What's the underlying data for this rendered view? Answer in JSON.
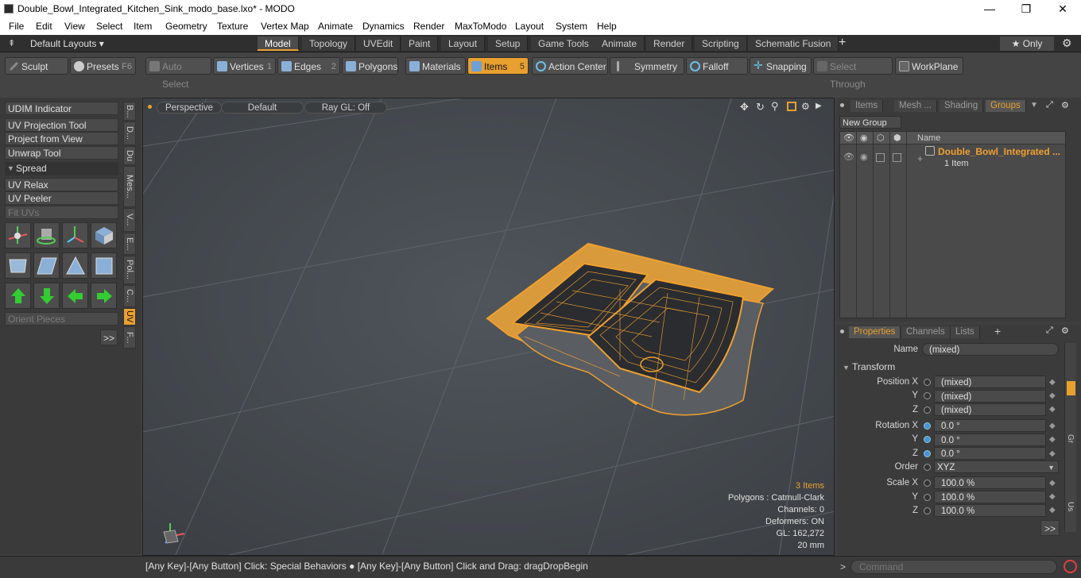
{
  "window": {
    "title": "Double_Bowl_Integrated_Kitchen_Sink_modo_base.lxo* - MODO",
    "minimize": "—",
    "maximize": "❐",
    "close": "✕"
  },
  "menu": [
    "File",
    "Edit",
    "View",
    "Select",
    "Item",
    "Geometry",
    "Texture",
    "Vertex Map",
    "Animate",
    "Dynamics",
    "Render",
    "MaxToModo",
    "Layout",
    "System",
    "Help"
  ],
  "layoutbar": {
    "layouts_label": "Default Layouts ▾",
    "tabs": [
      "Model",
      "Topology",
      "UVEdit",
      "Paint",
      "Layout",
      "Setup",
      "Game Tools",
      "Animate",
      "Render",
      "Scripting",
      "Schematic Fusion"
    ],
    "active_tab": "Model",
    "add": "+",
    "only_label": "★  Only"
  },
  "toolbar": {
    "sculpt": "Sculpt",
    "presets": "Presets",
    "presets_key": "F6",
    "auto_select": "Auto Select",
    "vertices": "Vertices",
    "vertices_key": "1",
    "edges": "Edges",
    "edges_key": "2",
    "polygons": "Polygons",
    "materials": "Materials",
    "items": "Items",
    "items_key": "5",
    "action_center": "Action Center",
    "symmetry": "Symmetry",
    "falloff": "Falloff",
    "snapping": "Snapping",
    "select_through": "Select Through",
    "workplane": "WorkPlane"
  },
  "leftpanel": {
    "udim": "UDIM Indicator",
    "uv_projection": "UV Projection Tool",
    "project_view": "Project from View",
    "unwrap": "Unwrap Tool",
    "spread": "Spread",
    "uv_relax": "UV Relax",
    "uv_peeler": "UV Peeler",
    "fit_uvs": "Fit UVs",
    "orient": "Orient Pieces",
    "more": ">>",
    "vtabs": [
      "B...",
      "D...",
      "Du",
      "Mes...",
      "V...",
      "E...",
      "Pol...",
      "C...",
      "UV",
      "F..."
    ]
  },
  "viewport": {
    "perspective": "Perspective",
    "default": "Default",
    "raygl": "Ray GL: Off",
    "items_count": "3 Items",
    "polygons": "Polygons : Catmull-Clark",
    "channels": "Channels: 0",
    "deformers": "Deformers: ON",
    "gl": "GL: 162,272",
    "unit": "20 mm"
  },
  "status": {
    "text": "[Any Key]-[Any Button] Click: Special Behaviors ● [Any Key]-[Any Button] Click and Drag: dragDropBegin"
  },
  "groups": {
    "tabs": [
      "Items",
      "Mesh ...",
      "Shading",
      "Groups"
    ],
    "active_tab": "Groups",
    "new_group": "New Group",
    "col_name": "Name",
    "group_name": "Double_Bowl_Integrated ...",
    "group_count": "1 Item"
  },
  "properties": {
    "tabs": [
      "Properties",
      "Channels",
      "Lists"
    ],
    "active_tab": "Properties",
    "add": "+",
    "name_label": "Name",
    "name_value": "(mixed)",
    "transform": "Transform",
    "position_x_label": "Position X",
    "position_x": "(mixed)",
    "position_y": "(mixed)",
    "position_z": "(mixed)",
    "rotation_x_label": "Rotation X",
    "rotation_x": "0.0 °",
    "rotation_y": "0.0 °",
    "rotation_z": "0.0 °",
    "order_label": "Order",
    "order_value": "XYZ",
    "scale_x_label": "Scale X",
    "scale_x": "100.0 %",
    "scale_y": "100.0 %",
    "scale_z": "100.0 %",
    "y_label": "Y",
    "z_label": "Z",
    "more": ">>",
    "side_tabs": [
      "Gr",
      "Us"
    ]
  },
  "command": {
    "placeholder": "Command",
    "prompt": ">"
  },
  "colors": {
    "accent": "#e8a02e",
    "mesh": "#f0a030"
  }
}
